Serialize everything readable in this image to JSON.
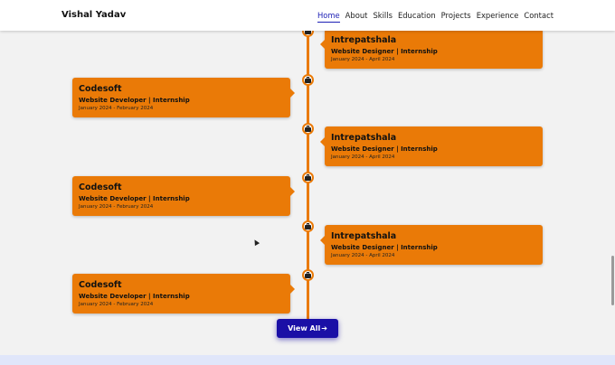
{
  "navbar": {
    "brand": "Vishal Yadav",
    "links": [
      {
        "label": "Home",
        "active": true
      },
      {
        "label": "About"
      },
      {
        "label": "Skills"
      },
      {
        "label": "Education"
      },
      {
        "label": "Projects"
      },
      {
        "label": "Experience"
      },
      {
        "label": "Contact"
      }
    ]
  },
  "timeline": {
    "items": [
      {
        "side": "right",
        "company": "Intrepatshala",
        "role": "Website Designer | Internship",
        "date": "January 2024 - April 2024"
      },
      {
        "side": "left",
        "company": "Codesoft",
        "role": "Website Developer | Internship",
        "date": "January 2024 - February 2024"
      },
      {
        "side": "right",
        "company": "Intrepatshala",
        "role": "Website Designer | Internship",
        "date": "January 2024 - April 2024"
      },
      {
        "side": "left",
        "company": "Codesoft",
        "role": "Website Developer | Internship",
        "date": "January 2024 - February 2024"
      },
      {
        "side": "right",
        "company": "Intrepatshala",
        "role": "Website Designer | Internship",
        "date": "January 2024 - April 2024"
      },
      {
        "side": "left",
        "company": "Codesoft",
        "role": "Website Developer | Internship",
        "date": "January 2024 - February 2024"
      }
    ],
    "node_icon": "briefcase-icon"
  },
  "view_all": {
    "label": "View All",
    "icon": "arrow-right-icon"
  },
  "colors": {
    "accent": "#ea7a07",
    "button": "#1a0fa6",
    "nav_active": "#1c1fb5"
  }
}
